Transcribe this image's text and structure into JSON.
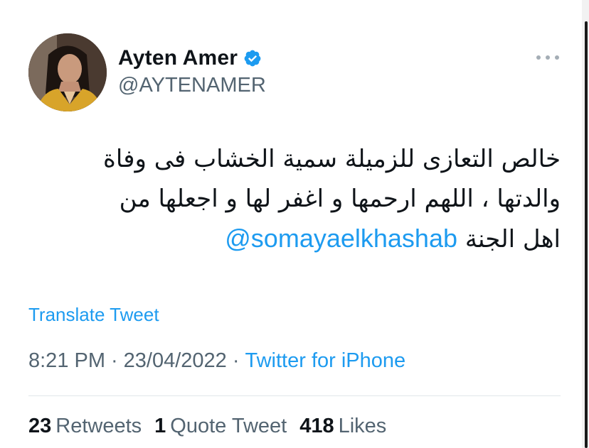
{
  "user": {
    "display_name": "Ayten Amer",
    "handle": "@AYTENAMER",
    "verified_icon": "verified-badge-icon"
  },
  "tweet": {
    "text_line_1": "خالص التعازى للزميلة سمية الخشاب فى وفاة",
    "text_line_2": "والدتها ، اللهم ارحمها و اغفر لها و اجعلها من",
    "text_line_3_prefix": "اهل الجنة",
    "mention": "@somayaelkhashab",
    "translate_label": "Translate Tweet",
    "time": "8:21 PM",
    "date": "23/04/2022",
    "separator": "·",
    "source": "Twitter for iPhone"
  },
  "stats": {
    "retweets_count": "23",
    "retweets_label": "Retweets",
    "quotes_count": "1",
    "quotes_label": "Quote Tweet",
    "likes_count": "418",
    "likes_label": "Likes"
  },
  "colors": {
    "accent": "#1d9bf0",
    "text_primary": "#0f1419",
    "text_secondary": "#536471"
  }
}
